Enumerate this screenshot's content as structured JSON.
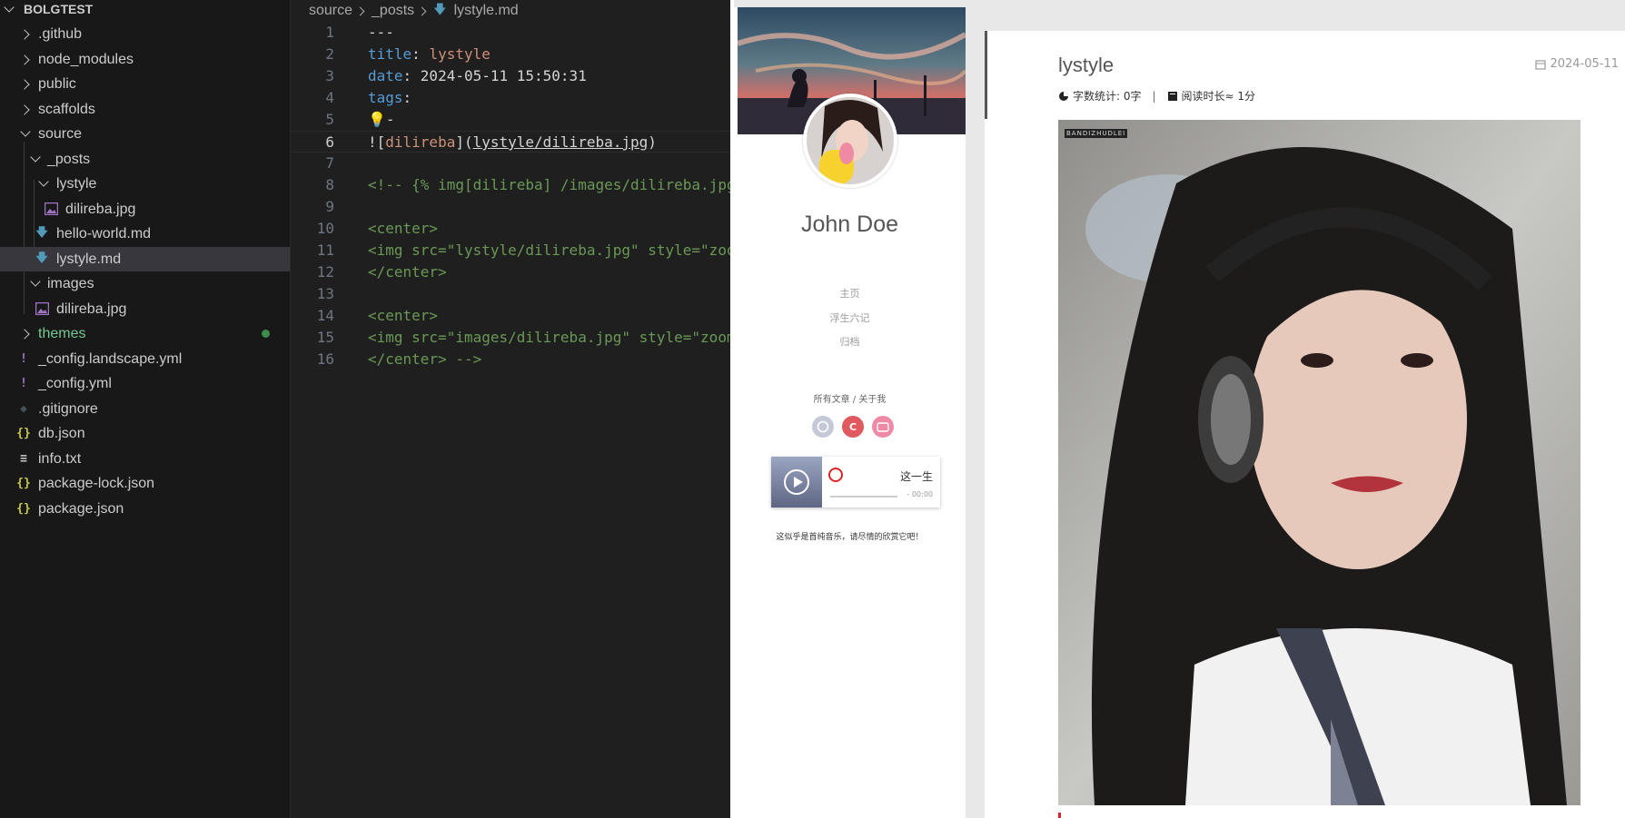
{
  "explorer": {
    "root_label": "BOLGTEST",
    "items": [
      {
        "label": ".github"
      },
      {
        "label": "node_modules"
      },
      {
        "label": "public"
      },
      {
        "label": "scaffolds"
      },
      {
        "label": "source"
      },
      {
        "label": "_posts"
      },
      {
        "label": "lystyle"
      },
      {
        "label": "dilireba.jpg"
      },
      {
        "label": "hello-world.md"
      },
      {
        "label": "lystyle.md"
      },
      {
        "label": "images"
      },
      {
        "label": "dilireba.jpg"
      },
      {
        "label": "themes"
      },
      {
        "label": "_config.landscape.yml"
      },
      {
        "label": "_config.yml"
      },
      {
        "label": ".gitignore"
      },
      {
        "label": "db.json"
      },
      {
        "label": "info.txt"
      },
      {
        "label": "package-lock.json"
      },
      {
        "label": "package.json"
      }
    ]
  },
  "editor": {
    "breadcrumb": {
      "part1": "source",
      "part2": "_posts",
      "file": "lystyle.md"
    },
    "line_numbers": [
      "1",
      "2",
      "3",
      "4",
      "5",
      "6",
      "7",
      "8",
      "9",
      "10",
      "11",
      "12",
      "13",
      "14",
      "15",
      "16"
    ],
    "code": {
      "l1": "---",
      "l2_key": "title",
      "l2_colon": ": ",
      "l2_val": "lystyle",
      "l3_key": "date",
      "l3_val": ": 2024-05-11 15:50:31",
      "l4_key": "tags",
      "l4_colon": ":",
      "l5_val": "-",
      "l6_a": "![",
      "l6_alt": "dilireba",
      "l6_b": "](",
      "l6_link": "lystyle/dilireba.jpg",
      "l6_c": ")",
      "l8": "<!-- {% img[dilireba] /images/dilireba.jpg",
      "l10": "<center>",
      "l11": "<img src=\"lystyle/dilireba.jpg\" style=\"zoo",
      "l12": "</center>",
      "l14": "<center>",
      "l15": "<img src=\"images/dilireba.jpg\" style=\"zoom",
      "l16": "</center> -->"
    }
  },
  "preview": {
    "author": "John Doe",
    "nav": [
      "主页",
      "浮生六记",
      "归档"
    ],
    "nav_sub": "所有文章 / 关于我",
    "player": {
      "title": "这一生",
      "time": "- 00:00",
      "progress": 0.0
    },
    "music_note": "这似乎是首纯音乐，请尽情的欣赏它吧！",
    "article": {
      "title": "lystyle",
      "date": "2024-05-11",
      "word_count": "字数统计: 0字",
      "separator": "|",
      "read_time": "阅读时长≈ 1分",
      "watermark": "BANDIZHUDLEI"
    },
    "social_icons": [
      "github-icon",
      "csdn-icon",
      "bilibili-icon"
    ]
  },
  "colors": {
    "accent_green": "#73c991",
    "modified_dot": "#3f8b4c",
    "yaml_key": "#569cd6",
    "yaml_string": "#ce9178",
    "comment": "#6a9955",
    "netease_red": "#e02424"
  }
}
